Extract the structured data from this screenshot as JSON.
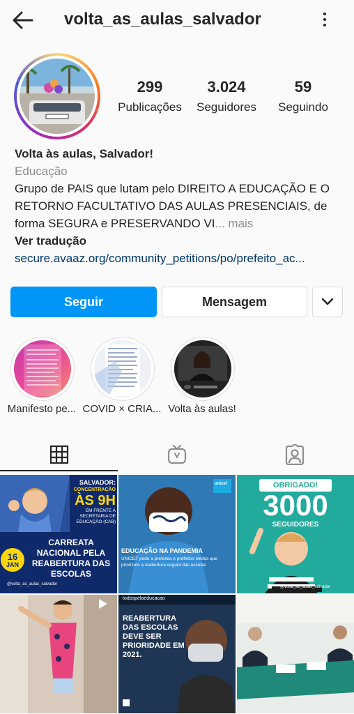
{
  "header": {
    "username": "volta_as_aulas_salvador"
  },
  "stats": [
    {
      "value": "299",
      "label": "Publicações"
    },
    {
      "value": "3.024",
      "label": "Seguidores"
    },
    {
      "value": "59",
      "label": "Seguindo"
    }
  ],
  "bio": {
    "name": "Volta às aulas, Salvador!",
    "category": "Educação",
    "text": "Grupo de PAIS que lutam pelo DIREITO A EDUCAÇÃO E O RETORNO FACULTATIVO DAS AULAS PRESENCIAIS, de forma SEGURA e PRESERVANDO VI",
    "more": "... mais",
    "translate": "Ver tradução",
    "link": "secure.avaaz.org/community_petitions/po/prefeito_ac..."
  },
  "actions": {
    "follow": "Seguir",
    "message": "Mensagem"
  },
  "highlights": [
    {
      "label": "Manifesto pe..."
    },
    {
      "label": "COVID × CRIA..."
    },
    {
      "label": "Volta às aulas!"
    }
  ],
  "posts": [
    {
      "title": "SALVADOR:",
      "line1": "CONCENTRAÇÃO",
      "time": "ÀS 9H",
      "place": "EM FRENTE A SECRETARIA DE EDUCAÇÃO (CAB)",
      "date_day": "16",
      "date_month": "JAN",
      "headline": "CARREATA NACIONAL PELA REABERTURA DAS ESCOLAS",
      "handle": "@volta_as_aulas_salvador"
    },
    {
      "badge": "unicef",
      "heading": "EDUCAÇÃO NA PANDEMIA",
      "body": "UNICEF pede a prefeitas e prefeitos eleitos que priorizem a reabertura segura das escolas"
    },
    {
      "top": "OBRIGADO!",
      "number": "3000",
      "label": "SEGUIDORES",
      "handle": "@volta_as_aulas_salvador"
    },
    {},
    {
      "handle": "todospelaeducacao",
      "headline": "Reabertura das escolas deve ser prioridade em 2021."
    },
    {}
  ],
  "colors": {
    "accent": "#0095f6",
    "link": "#00376b",
    "muted": "#8e8e8e"
  }
}
